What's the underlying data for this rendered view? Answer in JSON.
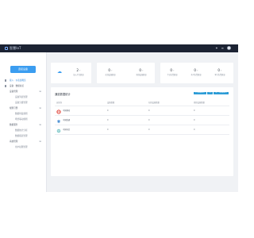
{
  "header": {
    "logo_text": "智慧IoT"
  },
  "sidebar": {
    "primary_button": "连接设备",
    "items": [
      {
        "label": "接入 · 仪表盘概览",
        "child": false,
        "active": true
      },
      {
        "label": "设备 · 数据总览",
        "child": false,
        "active": false
      },
      {
        "label": "设备管理",
        "child": false,
        "active": false,
        "expandable": true
      },
      {
        "label": "设备列表管理",
        "child": true
      },
      {
        "label": "设备分组管理",
        "child": true
      },
      {
        "label": "规则引擎",
        "child": false,
        "active": false,
        "expandable": true
      },
      {
        "label": "数据转发规则",
        "child": true
      },
      {
        "label": "场景联动规则",
        "child": true
      },
      {
        "label": "数据服务",
        "child": false,
        "active": false,
        "expandable": true
      },
      {
        "label": "数据统计分析",
        "child": true
      },
      {
        "label": "数据报表管理",
        "child": true
      },
      {
        "label": "系统管理",
        "child": false,
        "active": false,
        "expandable": true
      },
      {
        "label": "用户权限管理",
        "child": true
      }
    ]
  },
  "stats": {
    "card_a": {
      "value": "2",
      "unit": "个",
      "label": "接入平台数量"
    },
    "card_b": [
      {
        "value": "0",
        "unit": "个",
        "label": "在线设备数量"
      },
      {
        "value": "0",
        "unit": "个",
        "label": "离线设备数量"
      }
    ],
    "card_c": [
      {
        "value": "0",
        "unit": "个",
        "label": "今日告警数量"
      },
      {
        "value": "0",
        "unit": "个",
        "label": "本月告警数量"
      },
      {
        "value": "0",
        "unit": "个",
        "label": "累计告警数量"
      }
    ]
  },
  "panel": {
    "title": "通道数据统计",
    "actions": [
      "今日数据统计",
      "7天",
      "近一月数据统计"
    ],
    "columns": [
      "运营商",
      "设备数量",
      "在线设备数量",
      "离线设备数量"
    ],
    "rows": [
      {
        "name": "中国移动",
        "values": [
          "0",
          "0",
          "0"
        ],
        "logo": "china-mobile-logo"
      },
      {
        "name": "中国联通",
        "values": [
          "0",
          "0",
          "0"
        ],
        "logo": "china-unicom-logo"
      },
      {
        "name": "中国电信",
        "values": [
          "0",
          "0",
          "0"
        ],
        "logo": "china-telecom-logo"
      }
    ]
  },
  "colors": {
    "accent": "#3b9df0",
    "topbar": "#1c2333",
    "panel_button": "#2a9bd6"
  }
}
